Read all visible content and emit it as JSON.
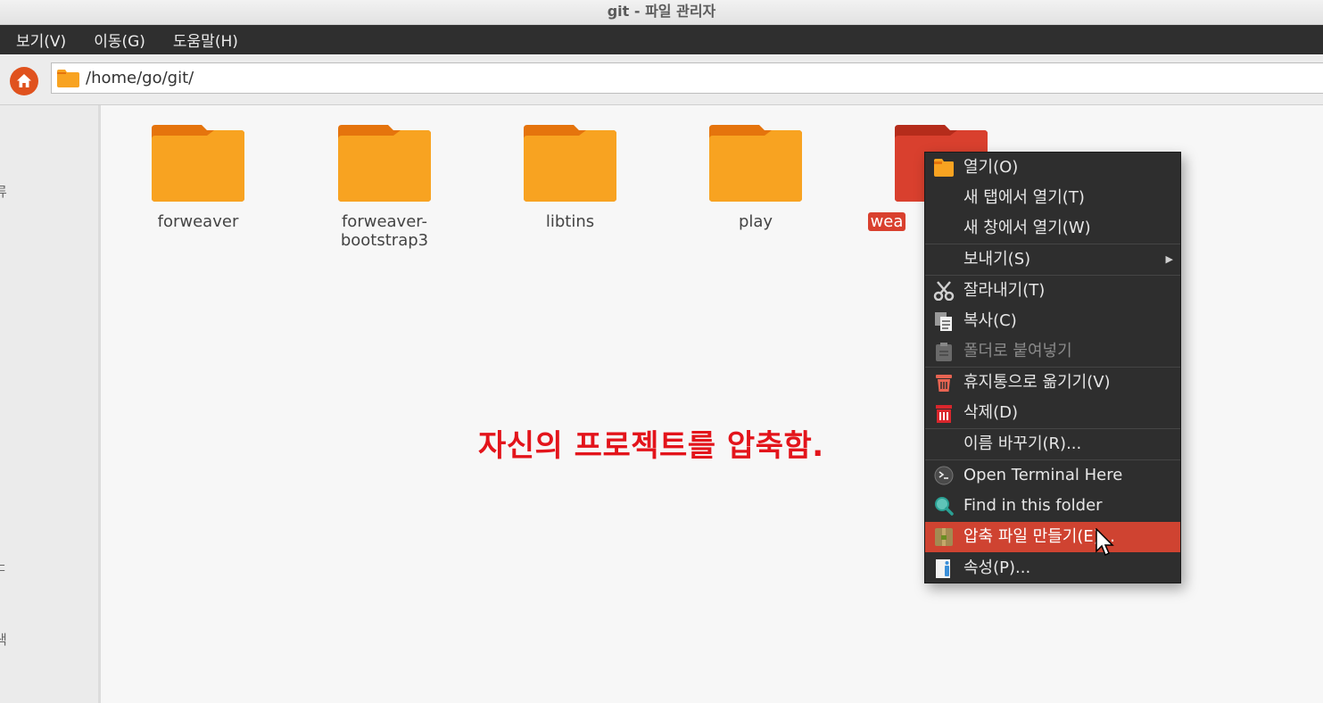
{
  "window": {
    "title": "git - 파일 관리자"
  },
  "menubar": {
    "items": [
      "보기(V)",
      "이동(G)",
      "도움말(H)"
    ]
  },
  "toolbar": {
    "path": "/home/go/git/"
  },
  "sidebar": {
    "partial_labels": [
      "류",
      "ㄷ",
      "색"
    ]
  },
  "files": [
    {
      "name": "forweaver",
      "selected": false
    },
    {
      "name": "forweaver-bootstrap3",
      "selected": false
    },
    {
      "name": "libtins",
      "selected": false
    },
    {
      "name": "play",
      "selected": false
    },
    {
      "name": "wea",
      "selected": true
    }
  ],
  "caption": "자신의 프로젝트를 압축함.",
  "context_menu": {
    "items": [
      {
        "label": "열기(O)",
        "icon": "folder-icon",
        "enabled": true
      },
      {
        "label": "새 탭에서 열기(T)",
        "icon": "",
        "enabled": true
      },
      {
        "label": "새 창에서 열기(W)",
        "icon": "",
        "enabled": true
      },
      {
        "label": "보내기(S)",
        "icon": "",
        "enabled": true,
        "submenu": true
      },
      {
        "label": "잘라내기(T)",
        "icon": "scissors-icon",
        "enabled": true
      },
      {
        "label": "복사(C)",
        "icon": "copy-icon",
        "enabled": true
      },
      {
        "label": "폴더로 붙여넣기",
        "icon": "paste-icon",
        "enabled": false
      },
      {
        "label": "휴지통으로 옮기기(V)",
        "icon": "trash-icon",
        "enabled": true
      },
      {
        "label": "삭제(D)",
        "icon": "delete-icon",
        "enabled": true
      },
      {
        "label": "이름 바꾸기(R)...",
        "icon": "",
        "enabled": true
      },
      {
        "label": "Open Terminal Here",
        "icon": "terminal-icon",
        "enabled": true
      },
      {
        "label": "Find in this folder",
        "icon": "search-icon",
        "enabled": true
      },
      {
        "label": "압축 파일 만들기(E)...",
        "icon": "archive-icon",
        "enabled": true,
        "highlighted": true
      },
      {
        "label": "속성(P)...",
        "icon": "properties-icon",
        "enabled": true
      }
    ]
  },
  "colors": {
    "folder": "#f8a321",
    "folder_tab": "#e5740d",
    "selected_folder": "#d9402e",
    "highlight": "#cf4331",
    "caption": "#e3141b",
    "menubar": "#2f2f2f"
  }
}
